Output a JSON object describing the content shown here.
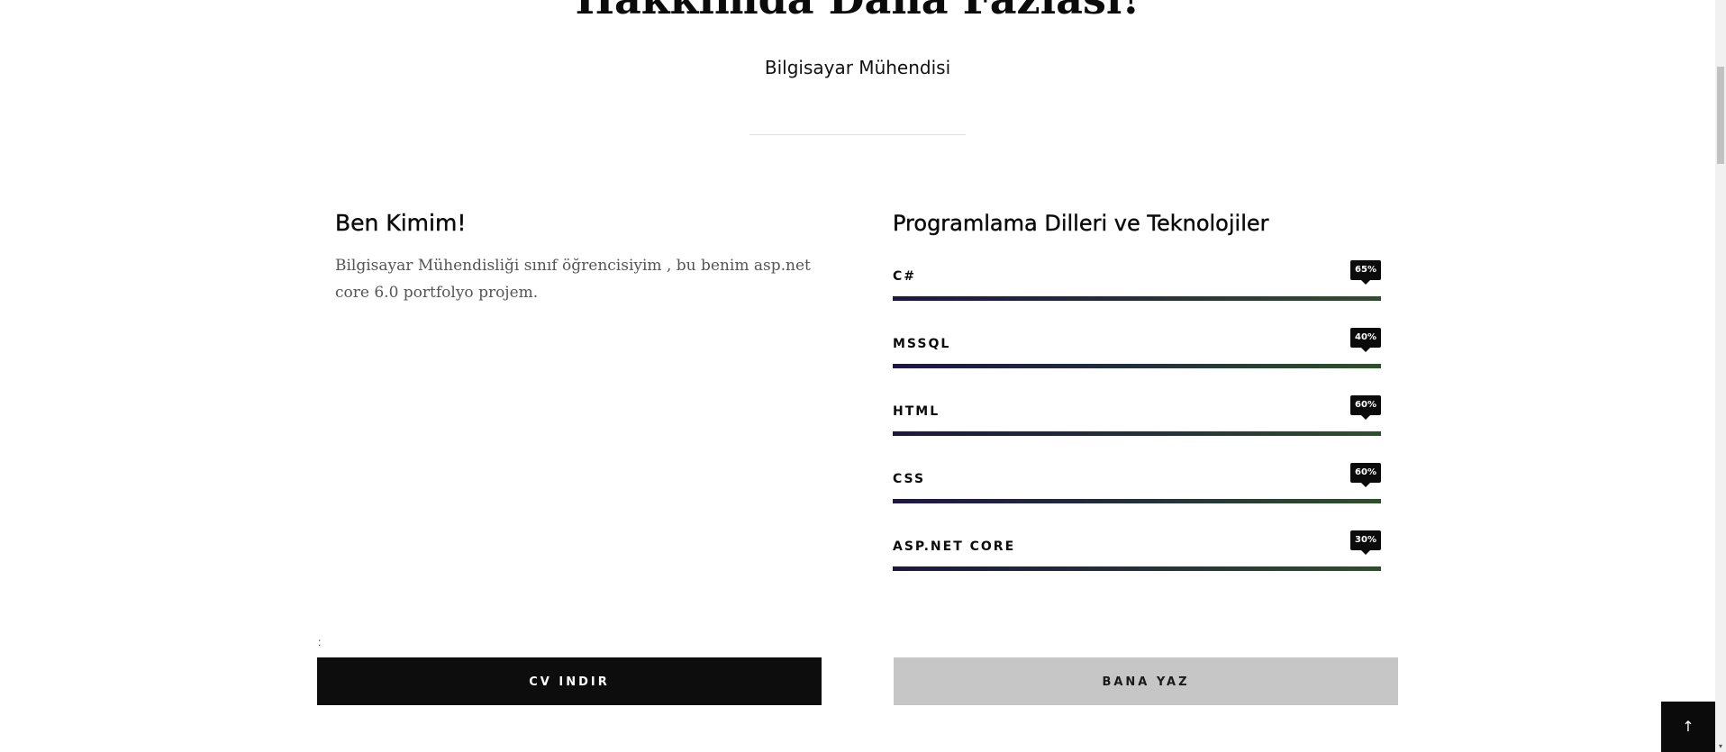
{
  "hero": {
    "title": "Hakkımda Daha Fazlası!",
    "subtitle": "Bilgisayar Mühendisi"
  },
  "about": {
    "heading": "Ben Kimim!",
    "body": "Bilgisayar Mühendisliği sınıf öğrencisiyim , bu benim asp.net core 6.0 portfolyo projem."
  },
  "skills": {
    "heading": "Programlama Dilleri ve Teknolojiler",
    "items": [
      {
        "name": "C#",
        "percent_label": "65%",
        "value": 65
      },
      {
        "name": "MSSQL",
        "percent_label": "40%",
        "value": 40
      },
      {
        "name": "HTML",
        "percent_label": "60%",
        "value": 60
      },
      {
        "name": "CSS",
        "percent_label": "60%",
        "value": 60
      },
      {
        "name": "ASP.NET CORE",
        "percent_label": "30%",
        "value": 30
      }
    ],
    "colors": {
      "bar_start": "#1d1742",
      "bar_end": "#2f4f2c",
      "badge": "#0b0b0b"
    }
  },
  "stray_text": ":",
  "buttons": {
    "cv_label": "CV INDIR",
    "contact_label": "BANA YAZ",
    "back_to_top_icon": "arrow-up-icon",
    "back_to_top_glyph": "↑"
  },
  "colors": {
    "primary_button": "#0e0d0e",
    "secondary_button": "#c6c6c6"
  }
}
